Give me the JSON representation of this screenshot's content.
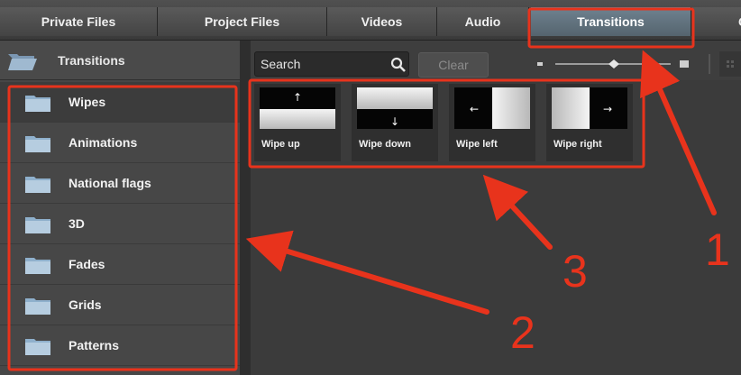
{
  "tabs": [
    {
      "label": "Private Files",
      "active": false
    },
    {
      "label": "Project Files",
      "active": false
    },
    {
      "label": "Videos",
      "active": false
    },
    {
      "label": "Audio",
      "active": false
    },
    {
      "label": "Transitions",
      "active": true
    },
    {
      "label": "Gr",
      "active": false
    }
  ],
  "sidebar": {
    "header": "Transitions",
    "categories": [
      {
        "label": "Wipes",
        "selected": true
      },
      {
        "label": "Animations",
        "selected": false
      },
      {
        "label": "National flags",
        "selected": false
      },
      {
        "label": "3D",
        "selected": false
      },
      {
        "label": "Fades",
        "selected": false
      },
      {
        "label": "Grids",
        "selected": false
      },
      {
        "label": "Patterns",
        "selected": false
      }
    ]
  },
  "toolbar": {
    "search_placeholder": "Search",
    "clear_label": "Clear"
  },
  "transitions": [
    {
      "label": "Wipe up",
      "arrow": "↑"
    },
    {
      "label": "Wipe down",
      "arrow": "↓"
    },
    {
      "label": "Wipe left",
      "arrow": "←"
    },
    {
      "label": "Wipe right",
      "arrow": "→"
    }
  ],
  "annotations": {
    "callout_1": "1",
    "callout_2": "2",
    "callout_3": "3",
    "color": "#e8331c"
  },
  "colors": {
    "active_tab": "#6f8290",
    "annotation_red": "#e8331c"
  }
}
